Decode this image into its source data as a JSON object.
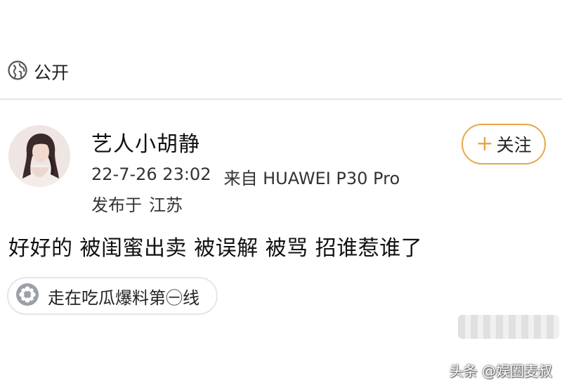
{
  "privacy": {
    "icon": "globe-icon",
    "label": "公开"
  },
  "author": {
    "name": "艺人小胡静",
    "timestamp": "22-7-26 23:02",
    "source": "来自 HUAWEI P30 Pro",
    "location_prefix": "发布于",
    "location": "江苏",
    "avatar_icon": "avatar-photo"
  },
  "follow_button": {
    "plus": "+",
    "label": "关注",
    "accent": "#e8a745"
  },
  "post": {
    "text": "好好的 被闺蜜出卖 被误解 被骂 招谁惹谁了"
  },
  "topic": {
    "icon": "topic-flower-icon",
    "label": "走在吃瓜爆料第㊀线",
    "icon_color": "#9aa0a6"
  },
  "watermark": {
    "text": "头条 @娱圈麦叔"
  }
}
